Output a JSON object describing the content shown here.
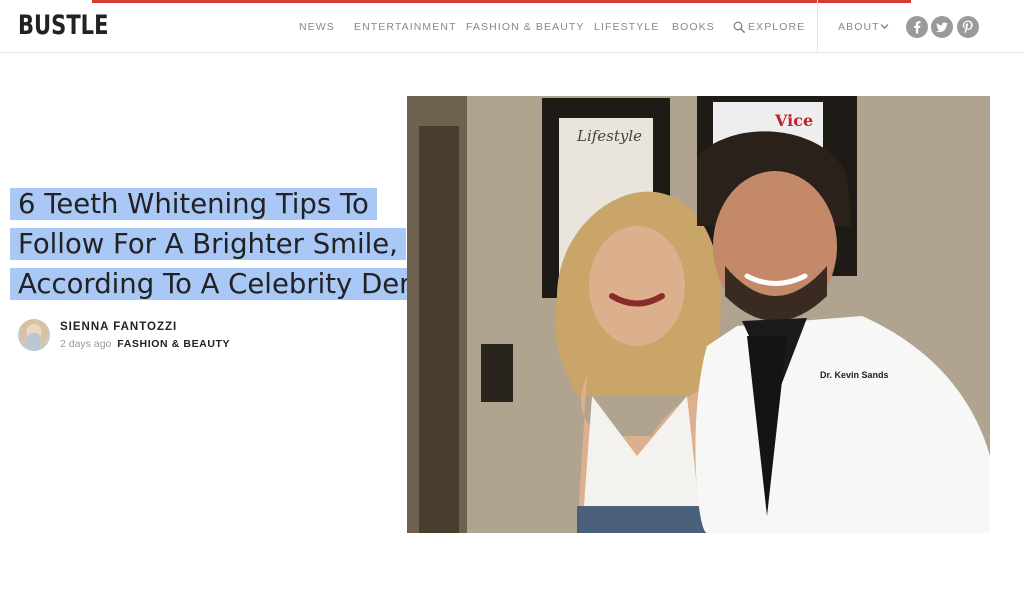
{
  "site": {
    "logo": "BUSTLE",
    "brand_color": "#d23f31",
    "reading_progress": 0.8
  },
  "nav": {
    "items": [
      {
        "label": "NEWS"
      },
      {
        "label": "ENTERTAINMENT"
      },
      {
        "label": "FASHION & BEAUTY"
      },
      {
        "label": "LIFESTYLE"
      },
      {
        "label": "BOOKS"
      },
      {
        "label": "EXPLORE",
        "icon": "search-icon"
      }
    ],
    "about": "ABOUT",
    "social": [
      {
        "icon": "facebook-icon"
      },
      {
        "icon": "twitter-icon"
      },
      {
        "icon": "pinterest-icon"
      }
    ]
  },
  "article": {
    "headline_lines": [
      "6 Teeth Whitening Tips To",
      "Follow For A Brighter Smile,",
      "According To A Celebrity Dentist"
    ],
    "selection_color": "#a9c8f6",
    "author": "SIENNA FANTOZZI",
    "time_ago": "2 days ago",
    "category": "FASHION & BEAUTY",
    "image": {
      "coat_text": "Dr. Kevin Sands",
      "poster_text": "Lifestyle"
    }
  }
}
